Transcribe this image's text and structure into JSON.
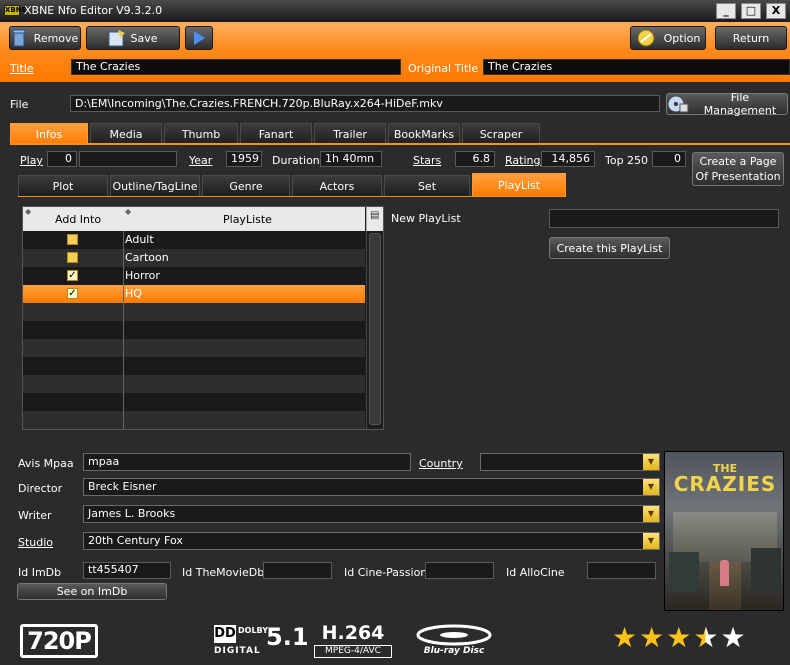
{
  "window": {
    "title": "XBNE Nfo Editor V9.3.2.0",
    "app_icon_text": "XBNE",
    "buttons": [
      "_",
      "□",
      "X"
    ]
  },
  "toolbar": {
    "remove_label": "Remove",
    "save_label": "Save",
    "option_label": "Option",
    "return_label": "Return"
  },
  "titles": {
    "title_label": "Title",
    "title_value": "The Crazies",
    "original_label": "Original Title",
    "original_value": "The Crazies"
  },
  "file": {
    "label": "File",
    "path": "D:\\EM\\Incoming\\The.Crazies.FRENCH.720p.BluRay.x264-HiDeF.mkv",
    "management_label": "File Management"
  },
  "main_tabs": [
    "Infos",
    "Media",
    "Thumb",
    "Fanart",
    "Trailer",
    "BookMarks",
    "Scraper"
  ],
  "info_row": {
    "play_label": "Play",
    "play_value": "0",
    "year_label": "Year",
    "year_value": "1959",
    "duration_label": "Duration",
    "duration_value": "1h 40mn",
    "stars_label": "Stars",
    "stars_value": "6.8",
    "ratings_label": "Ratings",
    "ratings_value": "14,856",
    "top_label": "Top 250",
    "top_value": "0",
    "create_page_line1": "Create a Page",
    "create_page_line2": "Of Presentation"
  },
  "sub_tabs": [
    "Plot",
    "Outline/TagLine",
    "Genre",
    "Actors",
    "Set",
    "PlayList"
  ],
  "playlist": {
    "col_add": "Add Into",
    "col_name": "PlayListe",
    "rows": [
      {
        "name": "Adult",
        "checked": false
      },
      {
        "name": "Cartoon",
        "checked": false
      },
      {
        "name": "Horror",
        "checked": true
      },
      {
        "name": "HQ",
        "checked": true
      }
    ],
    "new_label": "New PlayList",
    "new_value": "",
    "create_label": "Create this PlayList"
  },
  "details": {
    "mpaa_label": "Avis Mpaa",
    "mpaa_value": "mpaa",
    "country_label": "Country",
    "country_value": "",
    "director_label": "Director",
    "director_value": "Breck Eisner",
    "writer_label": "Writer",
    "writer_value": "James L. Brooks",
    "studio_label": "Studio",
    "studio_value": "20th Century Fox",
    "imdb_label": "Id ImDb",
    "imdb_value": "tt455407",
    "tmdb_label": "Id TheMovieDb",
    "tmdb_value": "",
    "cine_label": "Id Cine-Passion",
    "cine_value": "",
    "allo_label": "Id AlloCine",
    "allo_value": "",
    "see_imdb_label": "See on ImDb"
  },
  "poster": {
    "line1": "THE",
    "line2": "CRAZIES"
  },
  "badges": {
    "resolution": "720P",
    "audio_brand": "DOLBY",
    "audio_sub": "DIGITAL",
    "audio_channels": "5.1",
    "video_codec": "H.264",
    "video_sub": "MPEG-4/AVC",
    "disc_brand": "Blu-ray Disc"
  },
  "rating": {
    "stars_filled": 3.5,
    "stars_total": 5
  },
  "colors": {
    "accent": "#ff8a1c",
    "star": "#ffc21a"
  }
}
